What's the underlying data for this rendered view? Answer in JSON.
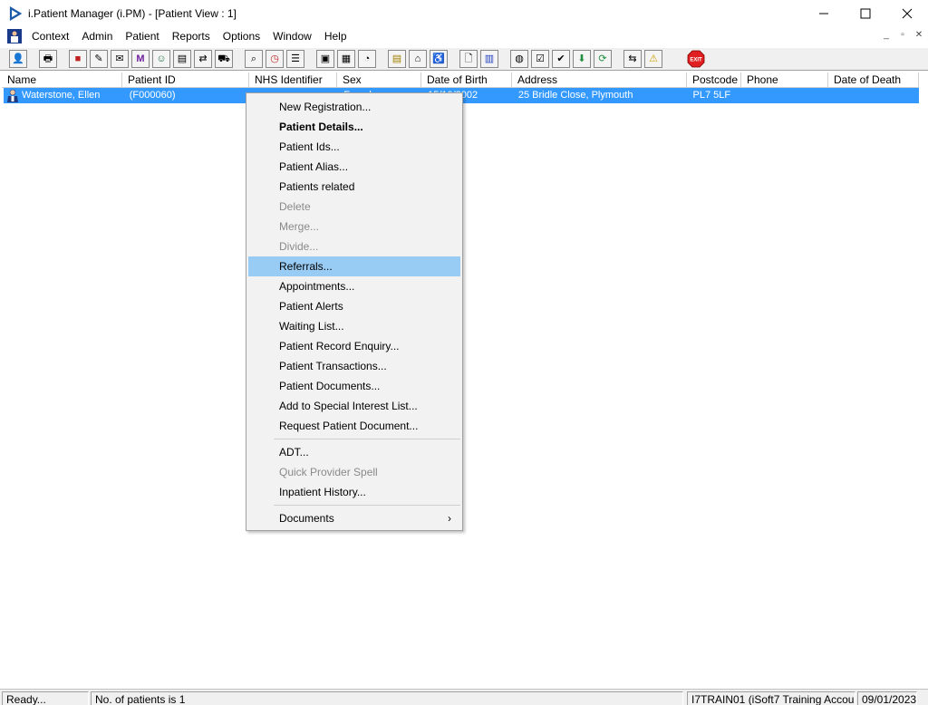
{
  "window": {
    "title": "i.Patient Manager (i.PM) - [Patient View : 1]",
    "controls": [
      "minimize",
      "maximize",
      "close"
    ]
  },
  "menubar": {
    "items": [
      "Context",
      "Admin",
      "Patient",
      "Reports",
      "Options",
      "Window",
      "Help"
    ]
  },
  "toolbar": {
    "exit_label": "EXIT"
  },
  "list": {
    "columns": [
      "Name",
      "Patient ID",
      "NHS Identifier",
      "Sex",
      "Date of Birth",
      "Address",
      "Postcode",
      "Phone",
      "Date of Death"
    ],
    "rows": [
      {
        "name": "Waterstone, Ellen",
        "patient_id": "(F000060)",
        "nhs": "",
        "sex": "Female",
        "dob": "15/10/2002",
        "address": "25 Bridle Close, Plymouth",
        "postcode": "PL7 5LF",
        "phone": "",
        "dod": ""
      }
    ]
  },
  "context_menu": {
    "items": [
      {
        "label": "New Registration..."
      },
      {
        "label": "Patient Details...",
        "bold": true
      },
      {
        "label": "Patient Ids..."
      },
      {
        "label": "Patient Alias..."
      },
      {
        "label": "Patients related"
      },
      {
        "label": "Delete",
        "disabled": true
      },
      {
        "label": "Merge...",
        "disabled": true
      },
      {
        "label": "Divide...",
        "disabled": true
      },
      {
        "label": "Referrals...",
        "highlighted": true
      },
      {
        "label": "Appointments..."
      },
      {
        "label": "Patient Alerts"
      },
      {
        "label": "Waiting List..."
      },
      {
        "label": "Patient Record Enquiry..."
      },
      {
        "label": "Patient Transactions..."
      },
      {
        "label": "Patient Documents..."
      },
      {
        "label": "Add to Special Interest List..."
      },
      {
        "label": "Request Patient Document..."
      },
      {
        "label": "ADT..."
      },
      {
        "label": "Quick Provider Spell",
        "disabled": true
      },
      {
        "label": "Inpatient History..."
      },
      {
        "label": "Documents",
        "submenu": true
      }
    ]
  },
  "statusbar": {
    "state": "Ready...",
    "count": "No. of patients is 1",
    "account": "I7TRAIN01 (iSoft7 Training Account)",
    "date": "09/01/2023"
  },
  "colors": {
    "selection": "#3399ff",
    "menu_highlight": "#99ccf5",
    "exit_red": "#e02020"
  }
}
